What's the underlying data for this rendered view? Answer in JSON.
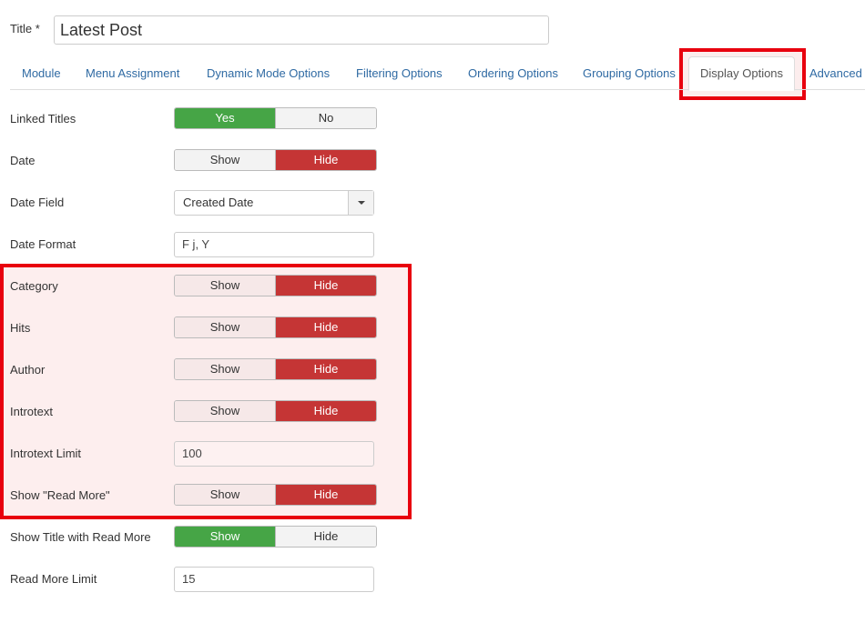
{
  "title_field": {
    "label": "Title *",
    "value": "Latest Post"
  },
  "tabs": [
    {
      "label": "Module"
    },
    {
      "label": "Menu Assignment"
    },
    {
      "label": "Dynamic Mode Options"
    },
    {
      "label": "Filtering Options"
    },
    {
      "label": "Ordering Options"
    },
    {
      "label": "Grouping Options"
    },
    {
      "label": "Display Options",
      "active": true
    },
    {
      "label": "Advanced"
    }
  ],
  "fields": {
    "linked_titles": {
      "label": "Linked Titles",
      "options": [
        "Yes",
        "No"
      ],
      "selected": "Yes"
    },
    "date": {
      "label": "Date",
      "options": [
        "Show",
        "Hide"
      ],
      "selected": "Hide"
    },
    "date_field": {
      "label": "Date Field",
      "value": "Created Date"
    },
    "date_format": {
      "label": "Date Format",
      "value": "F j, Y"
    },
    "category": {
      "label": "Category",
      "options": [
        "Show",
        "Hide"
      ],
      "selected": "Hide"
    },
    "hits": {
      "label": "Hits",
      "options": [
        "Show",
        "Hide"
      ],
      "selected": "Hide"
    },
    "author": {
      "label": "Author",
      "options": [
        "Show",
        "Hide"
      ],
      "selected": "Hide"
    },
    "introtext": {
      "label": "Introtext",
      "options": [
        "Show",
        "Hide"
      ],
      "selected": "Hide"
    },
    "introtext_limit": {
      "label": "Introtext Limit",
      "value": "100"
    },
    "show_read_more": {
      "label": "Show \"Read More\"",
      "options": [
        "Show",
        "Hide"
      ],
      "selected": "Hide"
    },
    "show_title_read_more": {
      "label": "Show Title with Read More",
      "options": [
        "Show",
        "Hide"
      ],
      "selected": "Show"
    },
    "read_more_limit": {
      "label": "Read More Limit",
      "value": "15"
    }
  },
  "colors": {
    "green": "#46a546",
    "red": "#c53535",
    "highlight": "#e8000e",
    "link": "#2f6aa3"
  }
}
